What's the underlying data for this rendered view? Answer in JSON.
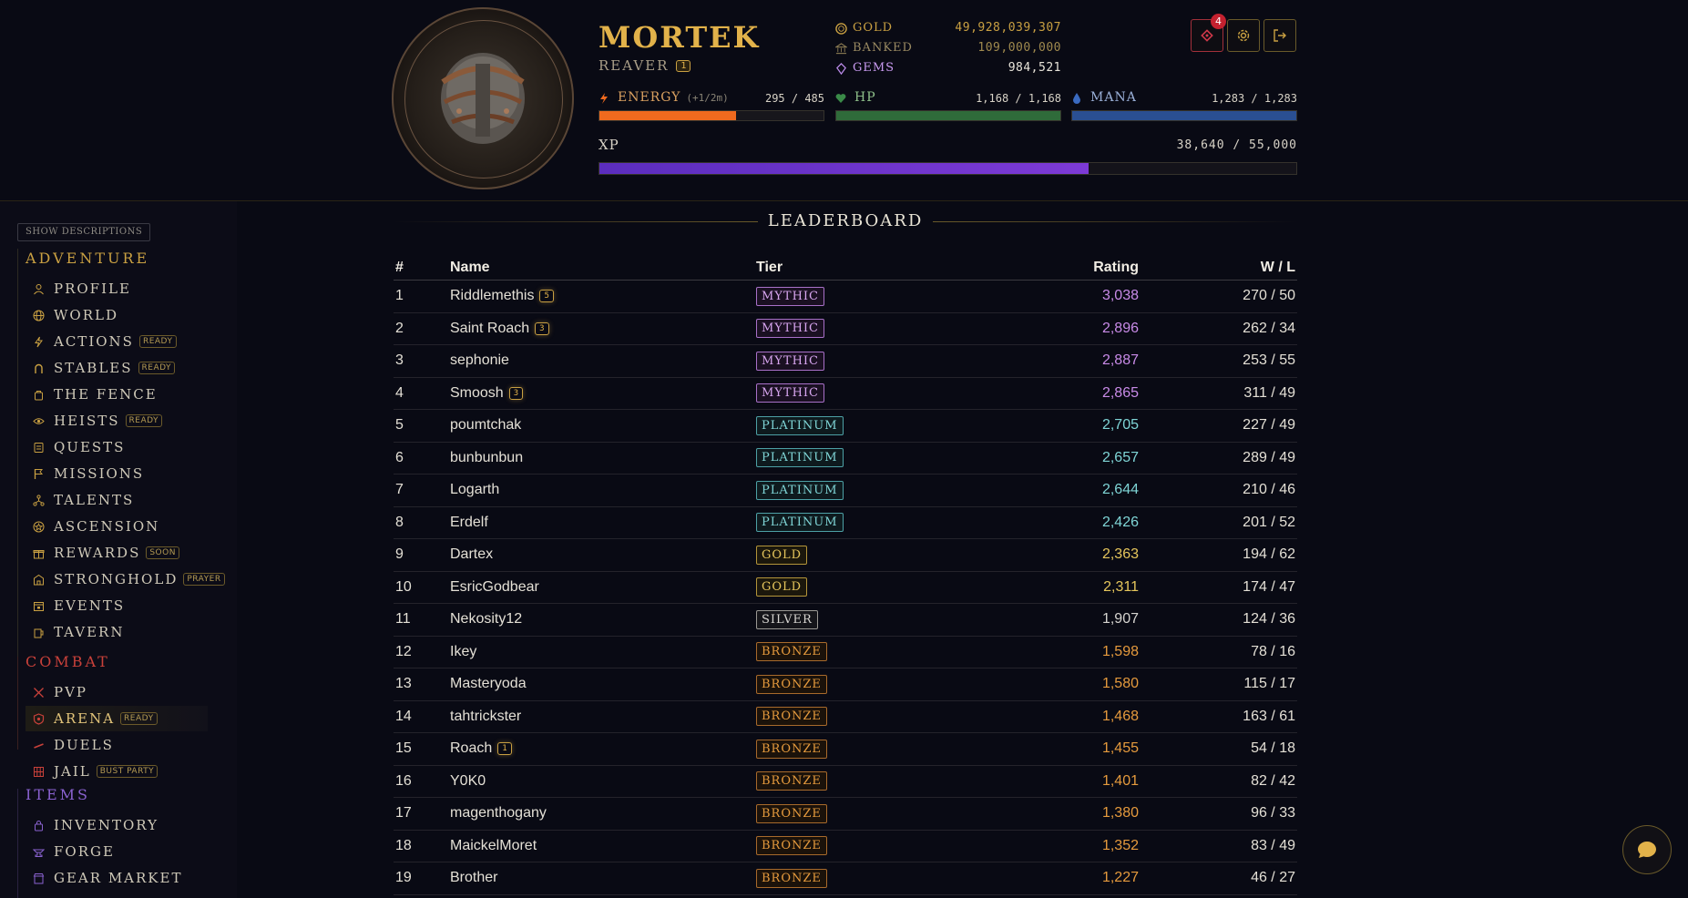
{
  "player": {
    "name": "MORTEK",
    "class": "REAVER",
    "level": "1"
  },
  "currencies": [
    {
      "label": "GOLD",
      "value": "49,928,039,307",
      "color": "#c9a042",
      "icon": "coin-icon"
    },
    {
      "label": "BANKED",
      "value": "109,000,000",
      "color": "#c9a042",
      "icon": "bank-icon"
    },
    {
      "label": "GEMS",
      "value": "984,521",
      "color": "#c89af0",
      "icon": "gem-icon"
    }
  ],
  "stats": {
    "energy": {
      "label": "ENERGY",
      "extra": "(+1/2m)",
      "value": "295 / 485",
      "fraction": 0.608,
      "color": "#f06a1e"
    },
    "hp": {
      "label": "HP",
      "value": "1,168 / 1,168",
      "fraction": 1.0,
      "color": "#2f6b3a"
    },
    "mana": {
      "label": "MANA",
      "value": "1,283 / 1,283",
      "fraction": 1.0,
      "color": "#2a4f92"
    }
  },
  "xp": {
    "label": "XP",
    "value": "38,640 / 55,000",
    "fraction": 0.7025
  },
  "notifications": {
    "count": "4"
  },
  "sidebar": {
    "show_descriptions": "SHOW DESCRIPTIONS",
    "adventure": {
      "title": "ADVENTURE",
      "color": "#c9a042",
      "items": [
        {
          "label": "PROFILE",
          "badge": ""
        },
        {
          "label": "WORLD",
          "badge": ""
        },
        {
          "label": "ACTIONS",
          "badge": "READY"
        },
        {
          "label": "STABLES",
          "badge": "READY"
        },
        {
          "label": "THE FENCE",
          "badge": ""
        },
        {
          "label": "HEISTS",
          "badge": "READY"
        },
        {
          "label": "QUESTS",
          "badge": ""
        },
        {
          "label": "MISSIONS",
          "badge": ""
        },
        {
          "label": "TALENTS",
          "badge": ""
        },
        {
          "label": "ASCENSION",
          "badge": ""
        },
        {
          "label": "REWARDS",
          "badge": "SOON"
        },
        {
          "label": "STRONGHOLD",
          "badge": "PRAYER"
        },
        {
          "label": "EVENTS",
          "badge": ""
        },
        {
          "label": "TAVERN",
          "badge": ""
        }
      ]
    },
    "combat": {
      "title": "COMBAT",
      "color": "#c9413a",
      "items": [
        {
          "label": "PVP",
          "badge": ""
        },
        {
          "label": "ARENA",
          "badge": "READY"
        },
        {
          "label": "DUELS",
          "badge": ""
        },
        {
          "label": "JAIL",
          "badge": "BUST PARTY"
        }
      ]
    },
    "items": {
      "title": "ITEMS",
      "color": "#8a62d0",
      "items": [
        {
          "label": "INVENTORY",
          "badge": ""
        },
        {
          "label": "FORGE",
          "badge": ""
        },
        {
          "label": "GEAR MARKET",
          "badge": ""
        }
      ]
    }
  },
  "leaderboard": {
    "title": "LEADERBOARD",
    "columns": {
      "rank": "#",
      "name": "Name",
      "tier": "Tier",
      "rating": "Rating",
      "wl": "W / L"
    },
    "tier_colors": {
      "MYTHIC": "#c98be8",
      "PLATINUM": "#7fd5d6",
      "GOLD": "#e6c65c",
      "SILVER": "#d6d4d0",
      "BRONZE": "#e59a3d"
    },
    "rows": [
      {
        "rank": "1",
        "name": "Riddlemethis",
        "level": "5",
        "tier": "MYTHIC",
        "rating": "3,038",
        "wl": "270 / 50"
      },
      {
        "rank": "2",
        "name": "Saint Roach",
        "level": "3",
        "tier": "MYTHIC",
        "rating": "2,896",
        "wl": "262 / 34"
      },
      {
        "rank": "3",
        "name": "sephonie",
        "level": "",
        "tier": "MYTHIC",
        "rating": "2,887",
        "wl": "253 / 55"
      },
      {
        "rank": "4",
        "name": "Smoosh",
        "level": "3",
        "tier": "MYTHIC",
        "rating": "2,865",
        "wl": "311 / 49"
      },
      {
        "rank": "5",
        "name": "poumtchak",
        "level": "",
        "tier": "PLATINUM",
        "rating": "2,705",
        "wl": "227 / 49"
      },
      {
        "rank": "6",
        "name": "bunbunbun",
        "level": "",
        "tier": "PLATINUM",
        "rating": "2,657",
        "wl": "289 / 49"
      },
      {
        "rank": "7",
        "name": "Logarth",
        "level": "",
        "tier": "PLATINUM",
        "rating": "2,644",
        "wl": "210 / 46"
      },
      {
        "rank": "8",
        "name": "Erdelf",
        "level": "",
        "tier": "PLATINUM",
        "rating": "2,426",
        "wl": "201 / 52"
      },
      {
        "rank": "9",
        "name": "Dartex",
        "level": "",
        "tier": "GOLD",
        "rating": "2,363",
        "wl": "194 / 62"
      },
      {
        "rank": "10",
        "name": "EsricGodbear",
        "level": "",
        "tier": "GOLD",
        "rating": "2,311",
        "wl": "174 / 47"
      },
      {
        "rank": "11",
        "name": "Nekosity12",
        "level": "",
        "tier": "SILVER",
        "rating": "1,907",
        "wl": "124 / 36"
      },
      {
        "rank": "12",
        "name": "Ikey",
        "level": "",
        "tier": "BRONZE",
        "rating": "1,598",
        "wl": "78 / 16"
      },
      {
        "rank": "13",
        "name": "Masteryoda",
        "level": "",
        "tier": "BRONZE",
        "rating": "1,580",
        "wl": "115 / 17"
      },
      {
        "rank": "14",
        "name": "tahtrickster",
        "level": "",
        "tier": "BRONZE",
        "rating": "1,468",
        "wl": "163 / 61"
      },
      {
        "rank": "15",
        "name": "Roach",
        "level": "1",
        "tier": "BRONZE",
        "rating": "1,455",
        "wl": "54 / 18"
      },
      {
        "rank": "16",
        "name": "Y0K0",
        "level": "",
        "tier": "BRONZE",
        "rating": "1,401",
        "wl": "82 / 42"
      },
      {
        "rank": "17",
        "name": "magenthogany",
        "level": "",
        "tier": "BRONZE",
        "rating": "1,380",
        "wl": "96 / 33"
      },
      {
        "rank": "18",
        "name": "MaickelMoret",
        "level": "",
        "tier": "BRONZE",
        "rating": "1,352",
        "wl": "83 / 49"
      },
      {
        "rank": "19",
        "name": "Brother",
        "level": "",
        "tier": "BRONZE",
        "rating": "1,227",
        "wl": "46 / 27"
      }
    ]
  }
}
